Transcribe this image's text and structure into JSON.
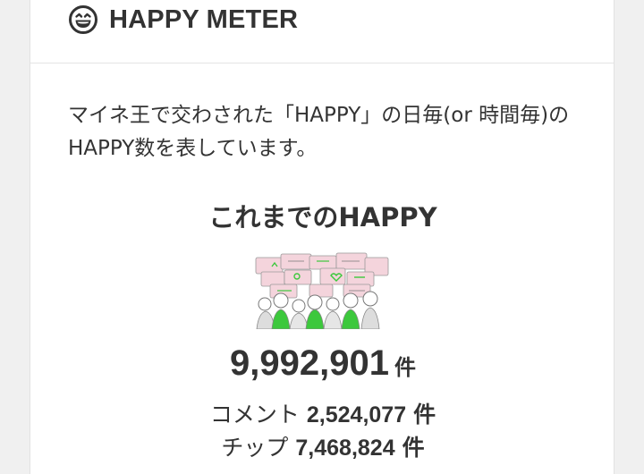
{
  "header": {
    "title": "HAPPY METER",
    "icon": "grinning-face-icon"
  },
  "description": "マイネ王で交わされた「HAPPY」の日毎(or 時間毎)のHAPPY数を表しています。",
  "section": {
    "title": "これまでのHAPPY"
  },
  "total": {
    "value": "9,992,901",
    "unit": "件"
  },
  "breakdown": [
    {
      "label": "コメント",
      "value": "2,524,077",
      "unit": "件"
    },
    {
      "label": "チップ",
      "value": "7,468,824",
      "unit": "件"
    }
  ],
  "colors": {
    "accent_green": "#3cc83c",
    "bubble_pink": "#f4d4dc",
    "text": "#333333"
  }
}
